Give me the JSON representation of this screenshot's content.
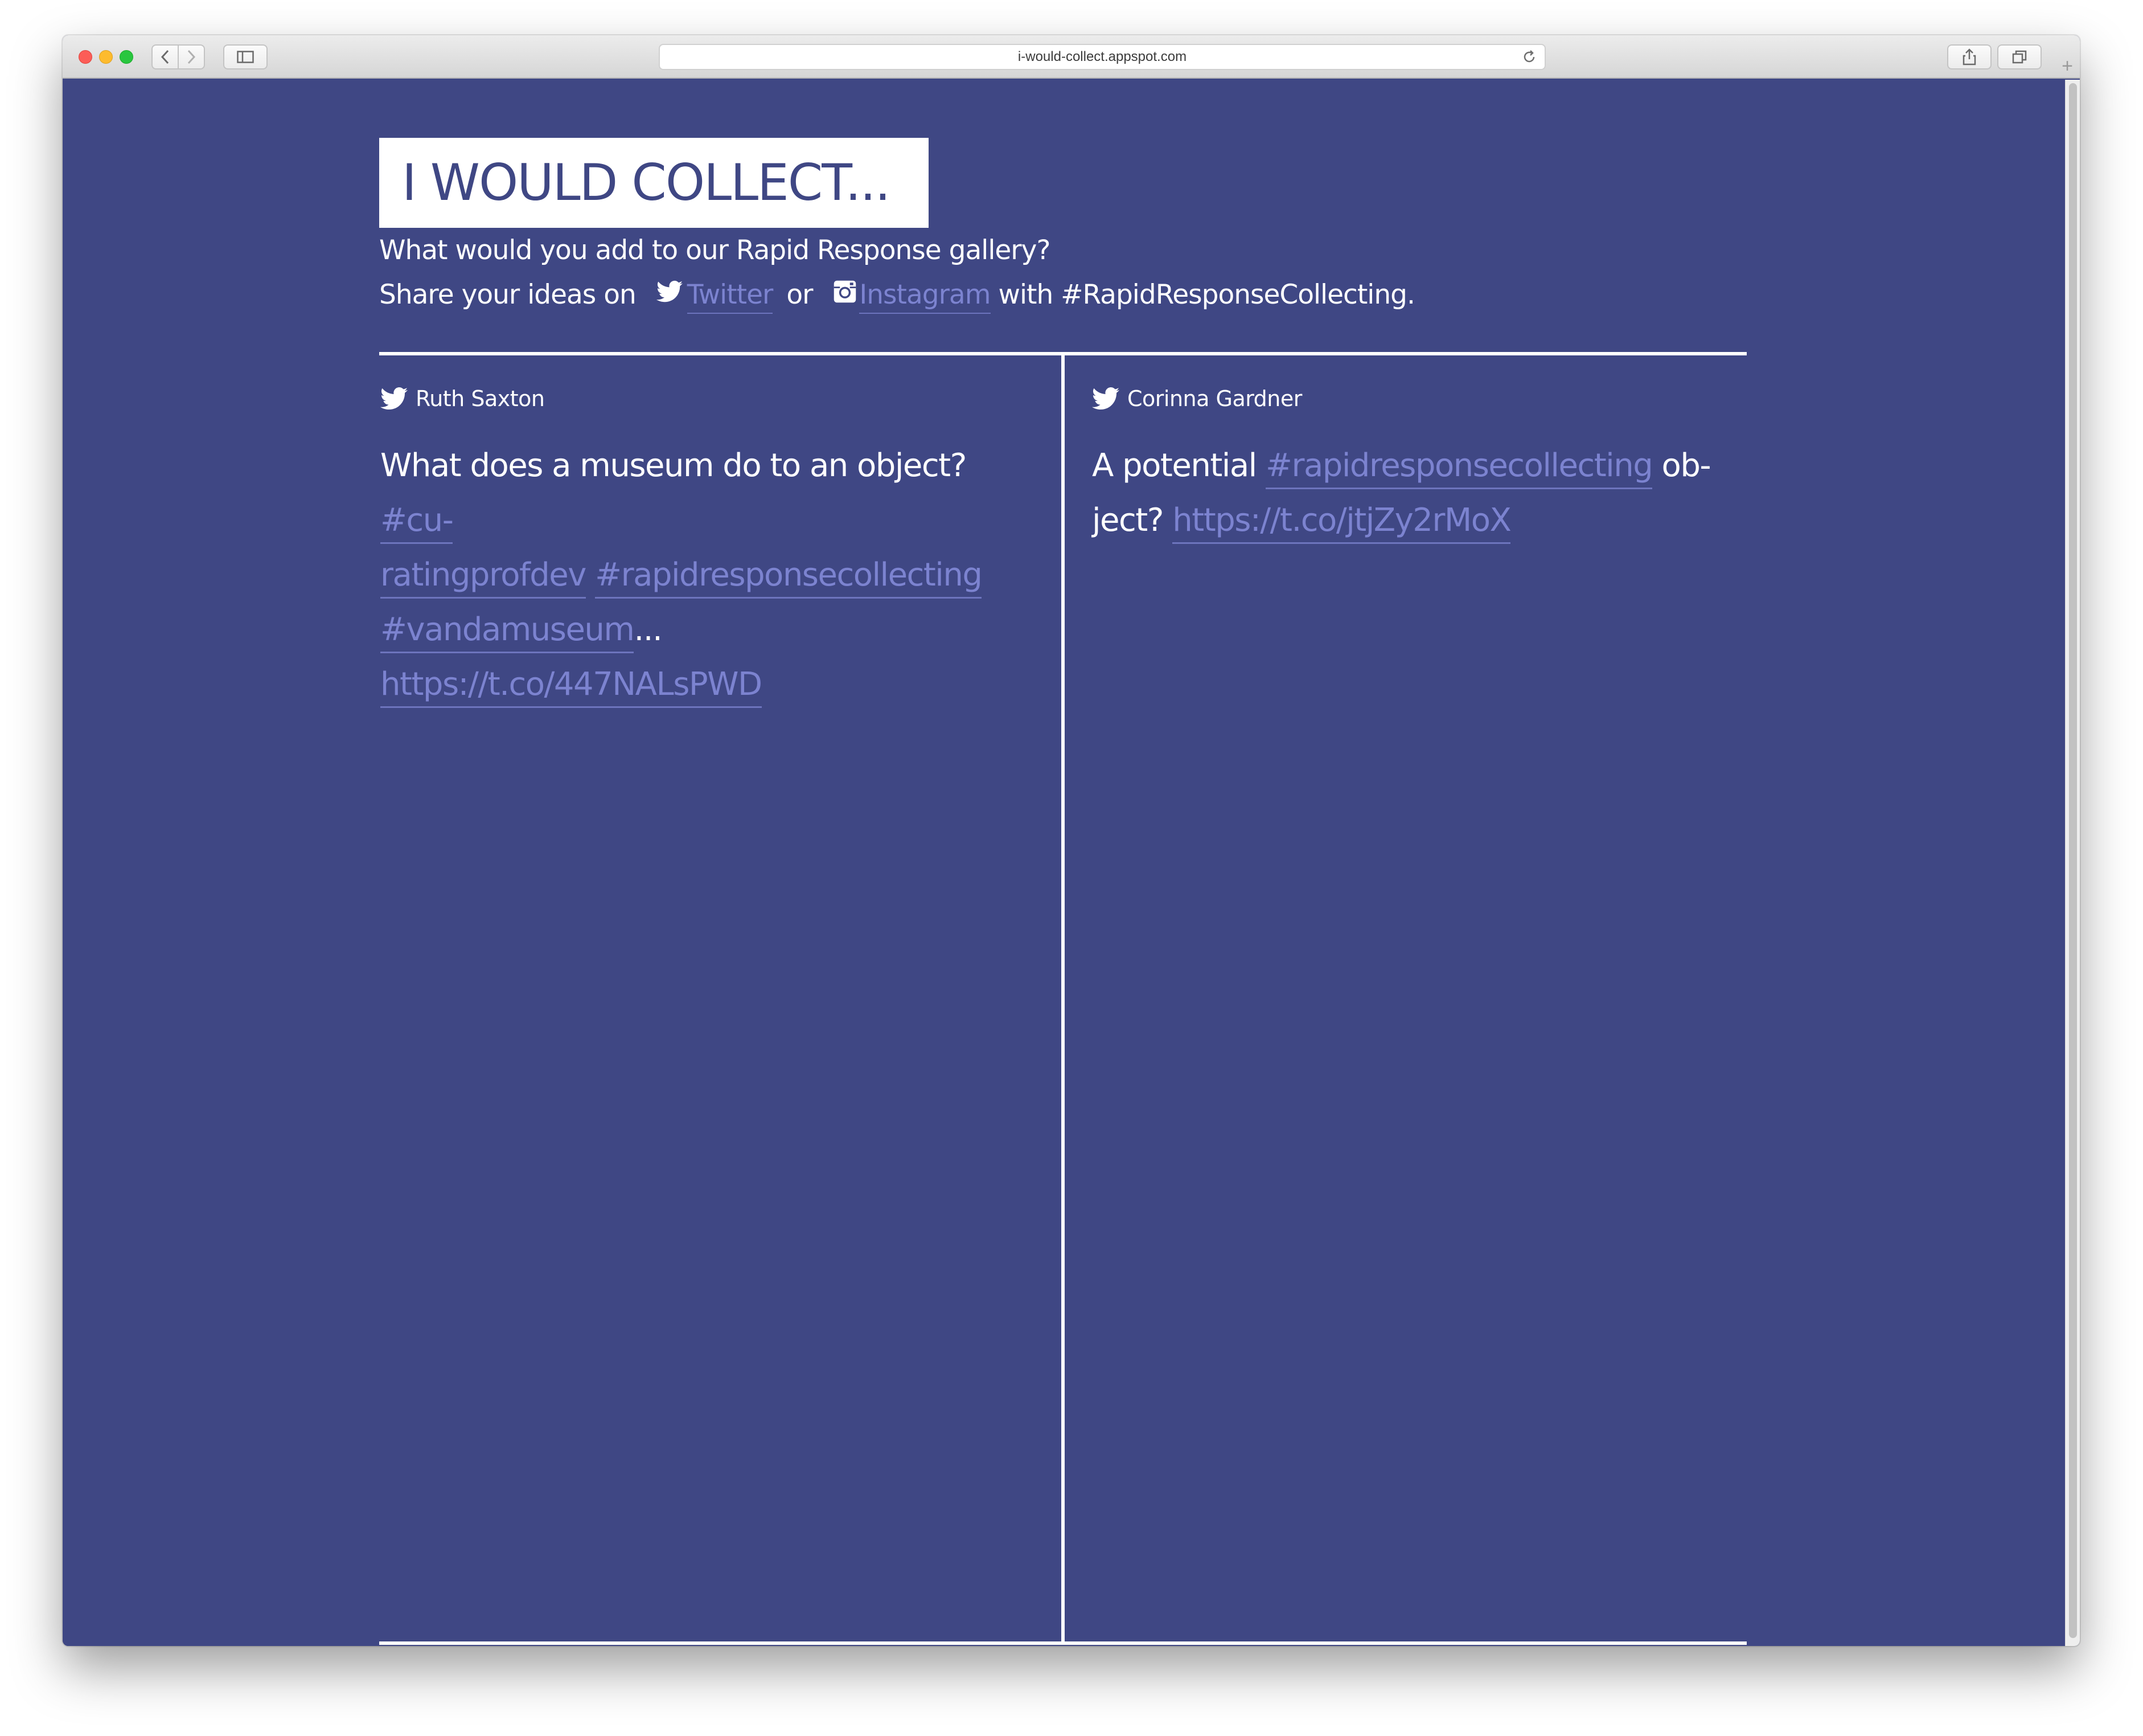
{
  "browser": {
    "url": "i-would-collect.appspot.com",
    "new_tab_glyph": "+"
  },
  "header": {
    "logo_text": "I WOULD COLLECT...",
    "tagline_line1": "What would you add to our Rapid Response gallery?",
    "tagline_prefix": "Share your ideas on",
    "twitter_label": "Twitter",
    "or_text": "or",
    "instagram_label": "Instagram",
    "tagline_suffix": "with #RapidResponseCollecting."
  },
  "tweets": [
    {
      "author": "Ruth Saxton",
      "text_plain_1": "What does a museum do to an object? ",
      "hashtag_1": "#cu-",
      "hashtag_1b": "ratingprofdev",
      "hashtag_2": "#rapidresponsecollecting",
      "hashtag_3": "#vandamuseum",
      "ellipsis": "...",
      "link": "https://t.co/447NALsPWD"
    },
    {
      "author": "Corinna Gardner",
      "text_plain_1": "A potential ",
      "hashtag_1": "#rapidresponsecollecting",
      "text_plain_2": " ob-",
      "text_plain_3": "ject? ",
      "link": "https://t.co/jtjZy2rMoX"
    }
  ],
  "colors": {
    "page_background": "#3f4784",
    "link": "#7c83d0",
    "text": "#ffffff"
  },
  "icons": [
    "twitter-icon",
    "instagram-icon",
    "back-icon",
    "forward-icon",
    "sidebar-icon",
    "reload-icon",
    "share-icon",
    "tabs-icon"
  ]
}
